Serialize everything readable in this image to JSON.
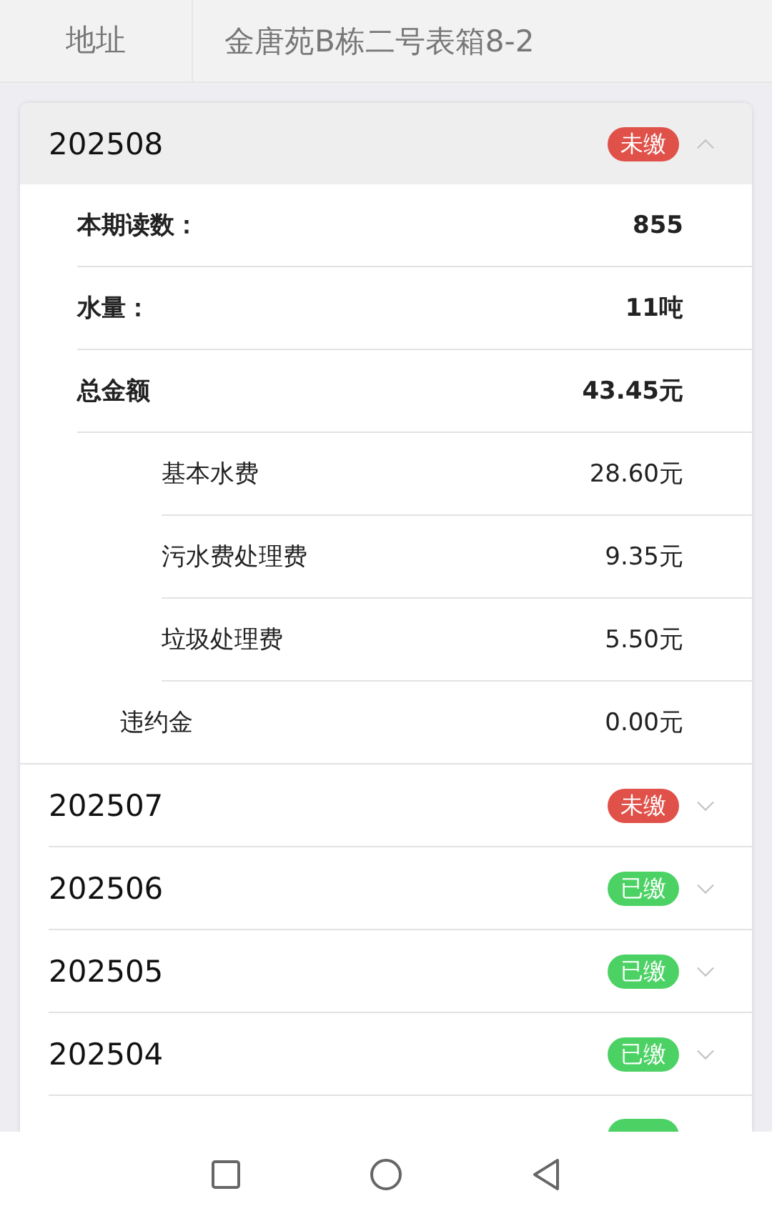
{
  "address": {
    "label": "地址",
    "value": "金唐苑B栋二号表箱8-2"
  },
  "bills": [
    {
      "period": "202508",
      "status": "未缴",
      "paid": false,
      "expanded": true,
      "details": [
        {
          "kind": "main",
          "label": "本期读数：",
          "value": "855"
        },
        {
          "kind": "main",
          "label": "水量：",
          "value": "11吨"
        },
        {
          "kind": "main",
          "label": "总金额",
          "value": "43.45元",
          "children": [
            {
              "kind": "sub",
              "label": "基本水费",
              "value": "28.60元"
            },
            {
              "kind": "sub",
              "label": "污水费处理费",
              "value": "9.35元"
            },
            {
              "kind": "sub",
              "label": "垃圾处理费",
              "value": "5.50元"
            }
          ]
        },
        {
          "kind": "extra",
          "label": "违约金",
          "value": "0.00元"
        }
      ]
    },
    {
      "period": "202507",
      "status": "未缴",
      "paid": false,
      "expanded": false
    },
    {
      "period": "202506",
      "status": "已缴",
      "paid": true,
      "expanded": false
    },
    {
      "period": "202505",
      "status": "已缴",
      "paid": true,
      "expanded": false
    },
    {
      "period": "202504",
      "status": "已缴",
      "paid": true,
      "expanded": false
    }
  ],
  "partial_row": {
    "paid": true
  }
}
